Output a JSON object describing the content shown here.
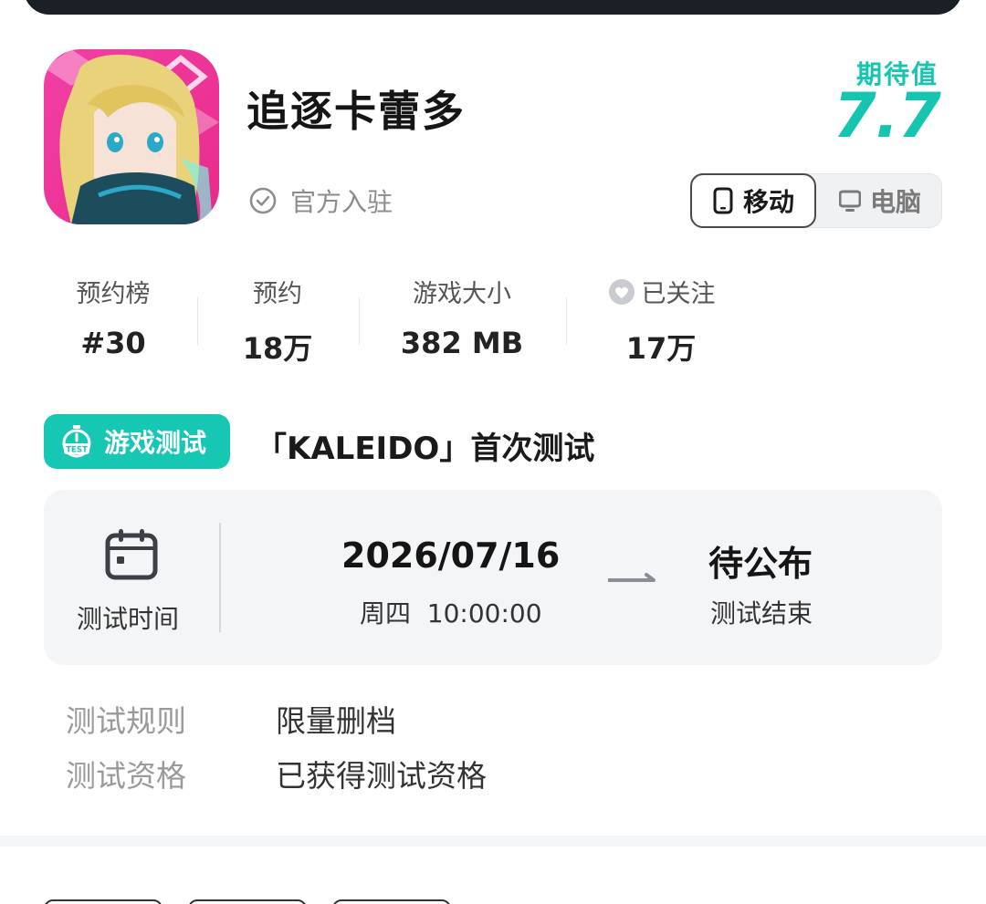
{
  "game": {
    "title": "追逐卡蕾多",
    "official_label": "官方入驻"
  },
  "expectation": {
    "label": "期待值",
    "score": "7.7",
    "color": "#15c5b0"
  },
  "platforms": [
    {
      "label": "移动",
      "icon": "phone-icon",
      "active": true
    },
    {
      "label": "电脑",
      "icon": "monitor-icon",
      "active": false
    }
  ],
  "stats": [
    {
      "label": "预约榜",
      "value": "#30"
    },
    {
      "label": "预约",
      "value": "18万"
    },
    {
      "label": "游戏大小",
      "value": "382 MB"
    },
    {
      "label": "已关注",
      "value": "17万",
      "icon": "heart-icon"
    }
  ],
  "test": {
    "badge_label": "游戏测试",
    "badge_icon_text": "TEST",
    "name": "「KALEIDO」首次测试",
    "time_label": "测试时间",
    "start_date": "2026/07/16",
    "start_time": "周四  10:00:00",
    "end_status": "待公布",
    "end_label": "测试结束",
    "rule_key": "测试规则",
    "rule_value": "限量删档",
    "qual_key": "测试资格",
    "qual_value": "已获得测试资格"
  }
}
